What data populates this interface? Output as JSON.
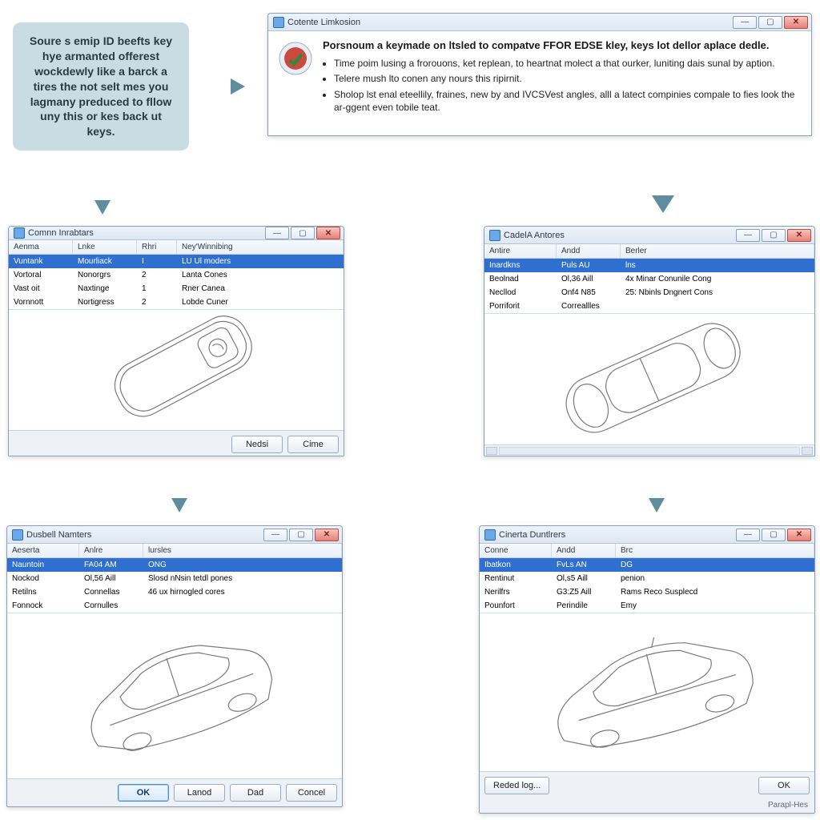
{
  "callout": {
    "text": "Soure s emip ID beefts key hye armanted offerest wockdewly like a barck a tires the not selt mes you lagmany preduced to fllow uny this or kes back ut keys."
  },
  "info_window": {
    "title": "Cotente Limkosion",
    "heading": "Porsnoum a keymade on ltsled to compatve FFOR EDSE kley, keys lot dellor aplace dedle.",
    "bullets": [
      "Time poim lusing a frorouons, ket replean, to heartnat molect a that ourker, luniting dais sunal by aption.",
      "Telere mush lto conen any nours this ripirnit.",
      "Sholop lst enal eteellily, fraines, new by and IVCSVest angles, alll a latect compinies compale to fies look the ar-ggent even tobile teat."
    ]
  },
  "win_a": {
    "title": "Comnn Inrabtars",
    "cols": [
      "Aenma",
      "Lnke",
      "Rhri",
      "Ney'Winnibing"
    ],
    "rows": [
      [
        "Vuntank",
        "Mourliack",
        "I",
        "LU Ul moders"
      ],
      [
        "Vortoral",
        "Nonorgrs",
        "2",
        "Lanta Cones"
      ],
      [
        "Vast oit",
        "Naxtinge",
        "1",
        "Rner Canea"
      ],
      [
        "Vornnott",
        "Nortigress",
        "2",
        "Lobde Cuner"
      ]
    ],
    "buttons": {
      "next": "Nedsi",
      "close": "Cime"
    }
  },
  "win_b": {
    "title": "CadelA Antores",
    "cols": [
      "Antire",
      "Andd",
      "Berler"
    ],
    "rows": [
      [
        "Inardkns",
        "Puls AU",
        "lns"
      ],
      [
        "Beolnad",
        "Ol,36 Aill",
        "4x Minar Conunile Cong"
      ],
      [
        "Necllod",
        "Onf4 N85",
        "25: Nbinls Dngnert Cons"
      ],
      [
        "Porriforit",
        "Correallles",
        ""
      ]
    ]
  },
  "win_c": {
    "title": "Dusbell Namters",
    "cols": [
      "Aeserta",
      "Anlre",
      "lursles"
    ],
    "rows": [
      [
        "Nauntoin",
        "FA04 AM",
        "ONG"
      ],
      [
        "Nockod",
        "Ol,56 Aill",
        "Slosd nNsin tetdl pones"
      ],
      [
        "Retilns",
        "Connellas",
        "46 ux hirnogled cores"
      ],
      [
        "Fonnock",
        "Cornulles",
        ""
      ]
    ],
    "buttons": {
      "ok": "OK",
      "lanod": "Lanod",
      "dad": "Dad",
      "cancel": "Concel"
    }
  },
  "win_d": {
    "title": "Cinerta Duntlrers",
    "cols": [
      "Conne",
      "Andd",
      "Brc"
    ],
    "rows": [
      [
        "Ibatkon",
        "FvLs AN",
        "DG"
      ],
      [
        "Rentinut",
        "Ol,s5 Aill",
        "penion"
      ],
      [
        "Nerilfrs",
        "G3:Z5 Aill",
        "Rams Reco Susplecd"
      ],
      [
        "Pounfort",
        "Perindile",
        "Emy"
      ]
    ],
    "buttons": {
      "reload": "Reded log...",
      "ok": "OK"
    },
    "status": "Parapl-Hes"
  },
  "colors": {
    "arrow": "#5f8d9d"
  }
}
